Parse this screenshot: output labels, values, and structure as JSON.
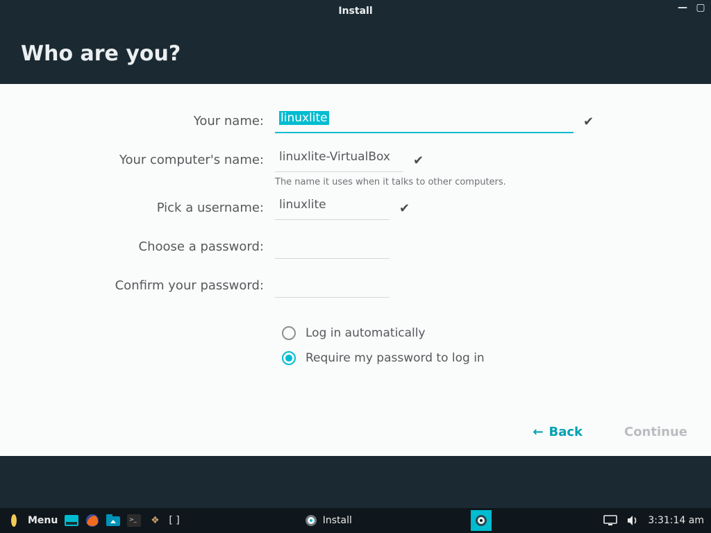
{
  "window": {
    "title": "Install",
    "heading": "Who are you?"
  },
  "name_field": {
    "label": "Your name:",
    "value": "linuxlite",
    "valid": true
  },
  "computer_field": {
    "label": "Your computer's name:",
    "value": "linuxlite-VirtualBox",
    "helper": "The name it uses when it talks to other computers.",
    "valid": true
  },
  "username_field": {
    "label": "Pick a username:",
    "value": "linuxlite",
    "valid": true
  },
  "password_field": {
    "label": "Choose a password:",
    "value": ""
  },
  "confirm_field": {
    "label": "Confirm your password:",
    "value": ""
  },
  "login_options": {
    "auto": "Log in automatically",
    "require": "Require my password to log in",
    "selected": "require"
  },
  "buttons": {
    "back": "Back",
    "continue": "Continue"
  },
  "taskbar": {
    "menu": "Menu",
    "workspaces": "[ ]",
    "active_task": "Install",
    "time": "3:31:14 am"
  }
}
